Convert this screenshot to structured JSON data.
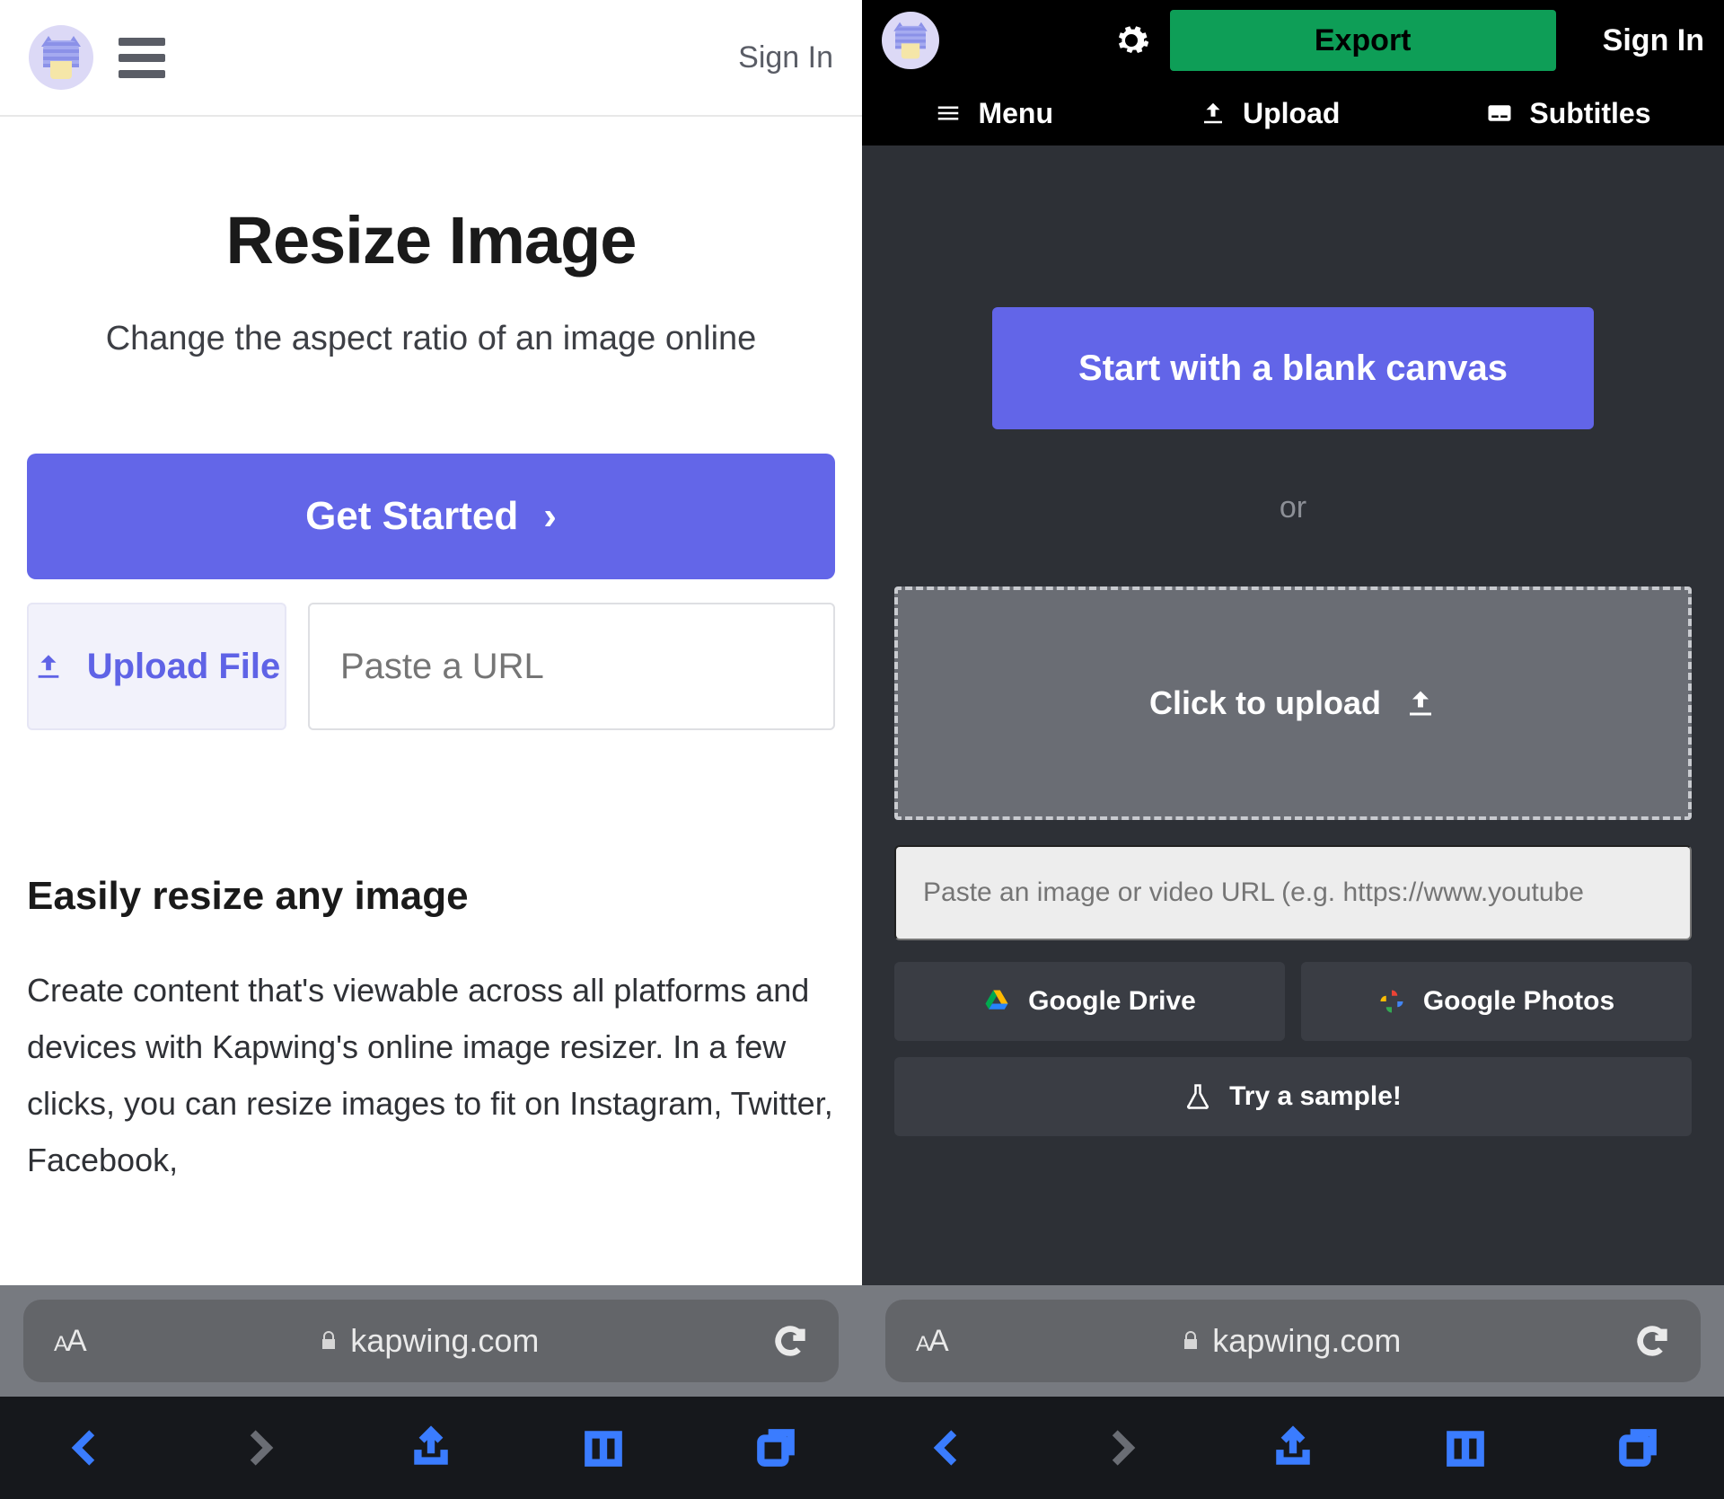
{
  "left": {
    "header": {
      "sign_in": "Sign In"
    },
    "title": "Resize Image",
    "subtitle": "Change the aspect ratio of an image online",
    "get_started": "Get Started",
    "upload_file": "Upload File",
    "url_placeholder": "Paste a URL",
    "section_heading": "Easily resize any image",
    "body_text": "Create content that's viewable across all platforms and devices with Kapwing's online image resizer. In a few clicks, you can resize images to fit on Instagram, Twitter, Facebook,"
  },
  "right": {
    "header": {
      "export": "Export",
      "sign_in": "Sign In",
      "tabs": {
        "menu": "Menu",
        "upload": "Upload",
        "subtitles": "Subtitles"
      }
    },
    "blank_canvas": "Start with a blank canvas",
    "or": "or",
    "click_upload": "Click to upload",
    "url_placeholder": "Paste an image or video URL (e.g. https://www.youtube",
    "google_drive": "Google Drive",
    "google_photos": "Google Photos",
    "try_sample": "Try a sample!"
  },
  "browser": {
    "domain": "kapwing.com"
  }
}
